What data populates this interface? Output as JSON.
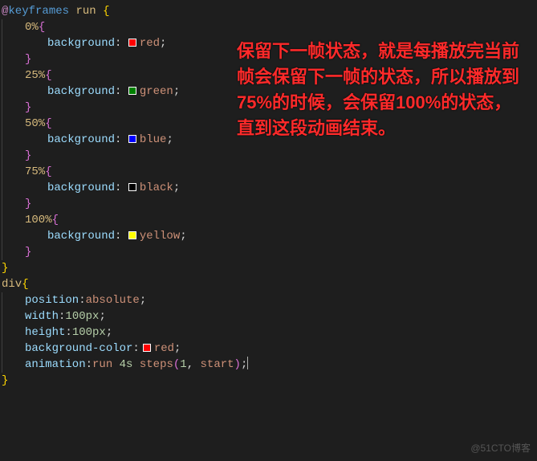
{
  "tokens": {
    "at": "@",
    "keyframes": "keyframes",
    "run": "run",
    "lbrace": "{",
    "rbrace": "}",
    "p0": "0%",
    "p25": "25%",
    "p50": "50%",
    "p75": "75%",
    "p100": "100%",
    "background": "background",
    "colon_sp": ": ",
    "colon": ":",
    "semi": ";",
    "red": "red",
    "green": "green",
    "blue": "blue",
    "black": "black",
    "yellow": "yellow",
    "div": "div",
    "position": "position",
    "absolute": "absolute",
    "width": "width",
    "height": "height",
    "hundredpx": "100px",
    "bgcolor": "background-color",
    "animation": "animation",
    "run_val": "run",
    "four_s": "4s",
    "steps": "steps",
    "lpar": "(",
    "one": "1",
    "comma_sp": ", ",
    "start": "start",
    "rpar": ")",
    "sp": " "
  },
  "colors": {
    "red": "#ff0000",
    "green": "#008000",
    "blue": "#0000ff",
    "black": "#000000",
    "yellow": "#ffff00"
  },
  "overlay_text": "保留下一帧状态，就是每播放完当前帧会保留下一帧的状态，所以播放到75%的时候，会保留100%的状态，直到这段动画结束。",
  "watermark": "@51CTO博客"
}
